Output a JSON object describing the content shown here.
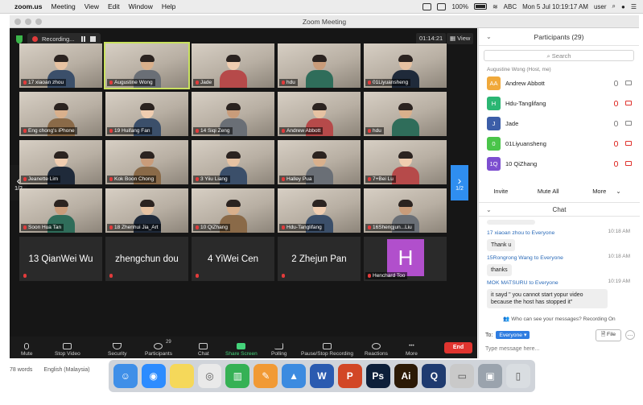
{
  "menubar": {
    "app": "zoom.us",
    "items": [
      "Meeting",
      "View",
      "Edit",
      "Window",
      "Help"
    ],
    "battery": "100%",
    "keyboard": "ABC",
    "clock": "Mon 5 Jul  10:19:17 AM",
    "user": "user"
  },
  "window": {
    "title": "Zoom Meeting"
  },
  "meeting": {
    "recording_label": "Recording...",
    "timer": "01:14:21",
    "view_label": "View",
    "page_left": "1/2",
    "page_right": "1/2"
  },
  "tiles": [
    {
      "name": "17 xiaoan zhou",
      "active": false
    },
    {
      "name": "Augustine Wong",
      "active": true
    },
    {
      "name": "Jade",
      "active": false
    },
    {
      "name": "hdu",
      "active": false
    },
    {
      "name": "01Liyuansheng",
      "active": false
    },
    {
      "name": "Eng chong's iPhone",
      "active": false
    },
    {
      "name": "19 Huifang Fan",
      "active": false
    },
    {
      "name": "14 Siqi Zeng",
      "active": false
    },
    {
      "name": "Andrew Abbott",
      "active": false
    },
    {
      "name": "hdu",
      "active": false
    },
    {
      "name": "Jeanette Lim",
      "active": false
    },
    {
      "name": "Kok Boon Chong",
      "active": false
    },
    {
      "name": "3 Yiiu Liang",
      "active": false
    },
    {
      "name": "Halley Pua",
      "active": false
    },
    {
      "name": "7+Bei Lu",
      "active": false
    },
    {
      "name": "Soon Hua Tan",
      "active": false
    },
    {
      "name": "18 Zhenhui Jia_Art",
      "active": false
    },
    {
      "name": "10 QiZhang",
      "active": false
    },
    {
      "name": "Hdu-Tanglifang",
      "active": false
    },
    {
      "name": "16Shengjun...Liu",
      "active": false
    }
  ],
  "name_tiles": [
    "13 QianWei Wu",
    "zhengchun dou",
    "4 YiWei Cen",
    "2 Zhejun Pan"
  ],
  "avatar_tile": {
    "letter": "H",
    "name": "Henchard Too",
    "color": "#b14fcc"
  },
  "toolbar": {
    "mute": "Mute",
    "stop_video": "Stop Video",
    "security": "Security",
    "participants": "Participants",
    "participants_count": "29",
    "chat": "Chat",
    "share_screen": "Share Screen",
    "polling": "Polling",
    "pause_recording": "Pause/Stop Recording",
    "reactions": "Reactions",
    "more": "More",
    "end": "End"
  },
  "status_bar": {
    "words": "78 words",
    "language": "English (Malaysia)"
  },
  "participants_panel": {
    "title": "Participants (29)",
    "search_placeholder": "Search",
    "cut_row": "Augustine Wong (Host, me)",
    "rows": [
      {
        "initials": "AA",
        "name": "Andrew Abbott",
        "color": "#f0a93b",
        "muted": false
      },
      {
        "initials": "H",
        "name": "Hdu-Tanglifang",
        "color": "#2bb673",
        "muted": true
      },
      {
        "initials": "J",
        "name": "Jade",
        "color": "#3c5ea8",
        "muted": false
      },
      {
        "initials": "0",
        "name": "01Liyuansheng",
        "color": "#4ac54a",
        "muted": true
      },
      {
        "initials": "1Q",
        "name": "10 QiZhang",
        "color": "#7d4fd0",
        "muted": true
      }
    ],
    "invite": "Invite",
    "mute_all": "Mute All",
    "more": "More"
  },
  "chat_panel": {
    "title": "Chat",
    "messages": [
      {
        "from": "17 xiaoan zhou to Everyone",
        "time": "10:18 AM",
        "text": "Thank u"
      },
      {
        "from": "15Rongrong Wang to Everyone",
        "time": "10:18 AM",
        "text": "thanks"
      },
      {
        "from": "MOK MATSURU to Everyone",
        "time": "10:19 AM",
        "text": "it sayd \" you cannot start yopur video because the host has stopped it\""
      }
    ],
    "who_can_see": "Who can see your messages? Recording On",
    "to_label": "To:",
    "to_target": "Everyone",
    "file_label": "File",
    "input_placeholder": "Type message here..."
  },
  "dock_apps": [
    {
      "name": "finder-icon",
      "glyph": "☺",
      "color": "#3f8fe8"
    },
    {
      "name": "zoom-icon",
      "glyph": "◉",
      "color": "#2d8cff"
    },
    {
      "name": "notes-icon",
      "glyph": "",
      "color": "#f5d85a"
    },
    {
      "name": "chrome-icon",
      "glyph": "◎",
      "color": "#e9e9e9"
    },
    {
      "name": "numbers-icon",
      "glyph": "▥",
      "color": "#35b155"
    },
    {
      "name": "pages-icon",
      "glyph": "✎",
      "color": "#f19a35"
    },
    {
      "name": "keynote-icon",
      "glyph": "▲",
      "color": "#3c8be0"
    },
    {
      "name": "word-icon",
      "glyph": "W",
      "color": "#2b5bb0"
    },
    {
      "name": "powerpoint-icon",
      "glyph": "P",
      "color": "#d24726"
    },
    {
      "name": "photoshop-icon",
      "glyph": "Ps",
      "color": "#0d1f3a"
    },
    {
      "name": "illustrator-icon",
      "glyph": "Ai",
      "color": "#2c1a06"
    },
    {
      "name": "quicktime-icon",
      "glyph": "Q",
      "color": "#1f3b70"
    },
    {
      "name": "preview-icon",
      "glyph": "▭",
      "color": "#c9c9c9"
    },
    {
      "name": "screenshot-icon",
      "glyph": "▣",
      "color": "#9aa3ad"
    },
    {
      "name": "trash-icon",
      "glyph": "▯",
      "color": "#d9dde1"
    }
  ]
}
